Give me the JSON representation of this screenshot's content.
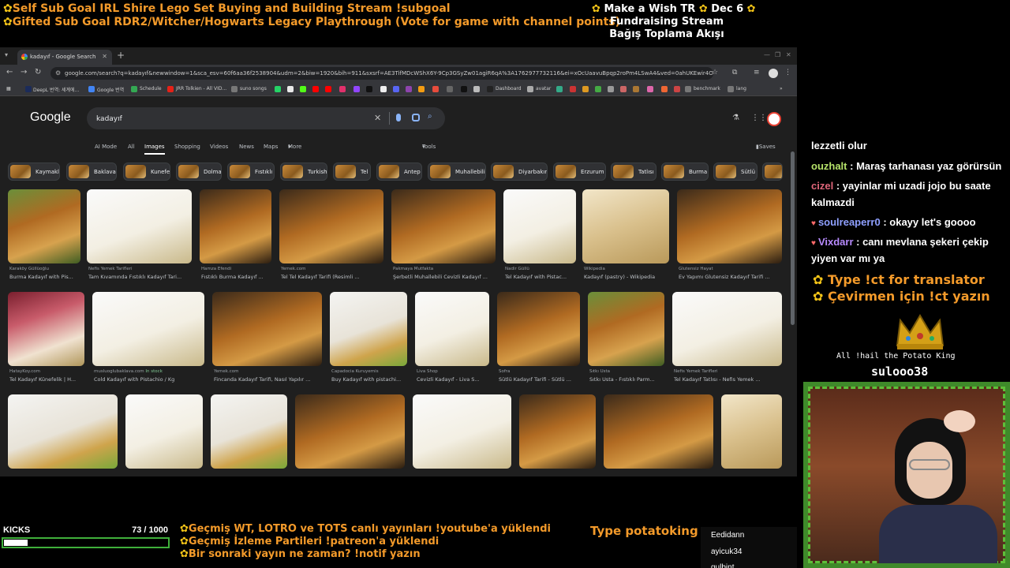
{
  "overlay": {
    "goal1": "Self Sub Goal IRL Shire Lego Set Buying and Building Stream !subgoal",
    "goal2": "Gifted Sub Goal RDR2/Witcher/Hogwarts Legacy Playthrough (Vote for game with channel points)",
    "wish_line1": "Make a Wish TR",
    "wish_date": "Dec 6",
    "wish_line2": "Fundraising Stream",
    "wish_line3": "Bağış Toplama Akışı"
  },
  "browser": {
    "tab_title": "kadayıf - Google Search",
    "url": "google.com/search?q=kadayıf&newwindow=1&sca_esv=60f6aa36f2538904&udm=2&biw=1920&bih=911&sxsrf=AE3TifMDcWShX6Y-9Cp3GSyZw01agiR6qA%3A1762977732116&ei=xOcUaavuBpqp2roPm4LSwA4&ved=0ahUKEwir4ODrs-2QAxWalF...",
    "bookmarks": [
      "DeepL 번역: 세계에...",
      "Google 번역",
      "Schedule",
      "JRR Tolkien - All VID...",
      "suno songs",
      "Dashboard",
      "avatar",
      "benchmark",
      "lang"
    ],
    "colors": {
      "chrome_bg": "#35363a",
      "page_bg": "#1f1f1f",
      "search_bg": "#303134"
    }
  },
  "google": {
    "logo": "Google",
    "query": "kadayıf",
    "tabs": [
      "AI Mode",
      "All",
      "Images",
      "Shopping",
      "Videos",
      "News",
      "Maps",
      "More"
    ],
    "active_tab": "Images",
    "tools": "Tools",
    "saves": "Saves",
    "chips": [
      "Kaymaklı",
      "Baklava",
      "Kunefe",
      "Dolma",
      "Fıstıklı",
      "Turkish",
      "Tel",
      "Antep",
      "Muhallebili",
      "Diyarbakır",
      "Erzurum",
      "Tatlısı",
      "Burma",
      "Sütlü"
    ],
    "row1": [
      {
        "src": "Karaköy Güllüoğlu",
        "cap": "Burma Kadayıf with Pis..."
      },
      {
        "src": "Nefis Yemek Tarifleri",
        "cap": "Tam Kıvamında Fıstıklı Kadayıf Tari..."
      },
      {
        "src": "Hamza Efendi",
        "cap": "Fıstıklı Burma Kadayıf ..."
      },
      {
        "src": "Yemek.com",
        "cap": "Tel Tel Kadayıf Tarifi (Resimli ..."
      },
      {
        "src": "Pakmaya Mutfakta",
        "cap": "Şerbetli Muhallebili Cevizli Kadayıf ..."
      },
      {
        "src": "Nadir Güllü",
        "cap": "Tel Kadayıf with Pistac..."
      },
      {
        "src": "Wikipedia",
        "cap": "Kadayıf (pastry) - Wikipedia"
      },
      {
        "src": "Glutensiz Hayat",
        "cap": "Ev Yapımı Glutensiz Kadayıf Tarifi ..."
      }
    ],
    "row2": [
      {
        "src": "HatayKoy.com",
        "cap": "Tel Kadayıf Künefelik | H..."
      },
      {
        "src": "musluoglubaklava.com",
        "stock": "In stock",
        "cap": "Cold Kadayıf with Pistachio / Kg"
      },
      {
        "src": "Yemek.com",
        "cap": "Fincanda Kadayıf Tarifi, Nasıl Yapılır ..."
      },
      {
        "src": "Capadocia Kuruyemis",
        "cap": "Buy Kadayıf with pistachi..."
      },
      {
        "src": "Liva Shop",
        "cap": "Cevizli Kadayıf - Liva S..."
      },
      {
        "src": "Sofra",
        "cap": "Sütlü Kadayıf Tarifi - Sütlü ..."
      },
      {
        "src": "Sıtkı Usta",
        "cap": "Sıtkı Usta - Fıstıklı Parm..."
      },
      {
        "src": "Nefis Yemek Tarifleri",
        "cap": "Tel Kadayıf Tatlısı - Nefis Yemek ..."
      }
    ]
  },
  "chat": {
    "line0": "lezzetli olur",
    "m1_user": "ouzhalt",
    "m1_text": ": Maraş tarhanası yaz görürsün",
    "m2_user": "cizel",
    "m2_text": ": yayinlar mi uzadi jojo bu saate",
    "m2_text2": "kalmazdi",
    "m3_user": "soulreaperr0",
    "m3_text": ": okayy let's goooo",
    "m4_user": "Vixdarr",
    "m4_text": ": canı mevlana şekeri çekip",
    "m4_text2": "yiyen var mı ya"
  },
  "translator": {
    "line1": "Type !ct for translator",
    "line2": "Çevirmen için !ct yazın"
  },
  "king": {
    "text": "All !hail the Potato King",
    "name": "sulooo38"
  },
  "kicks": {
    "label": "KICKS",
    "count": "73  / 1000",
    "progress": 0.073
  },
  "bottom": {
    "line1": "Geçmiş WT, LOTRO ve TOTS canlı yayınları !youtube'a yüklendi",
    "line2": "Geçmiş İzleme Partileri !patreon'a yüklendi",
    "line3": "Bir sonraki yayın ne zaman? !notif yazın",
    "potato": "Type potatoking"
  },
  "viewers": [
    "Eedidann",
    "ayicuk34",
    "gulbint"
  ]
}
